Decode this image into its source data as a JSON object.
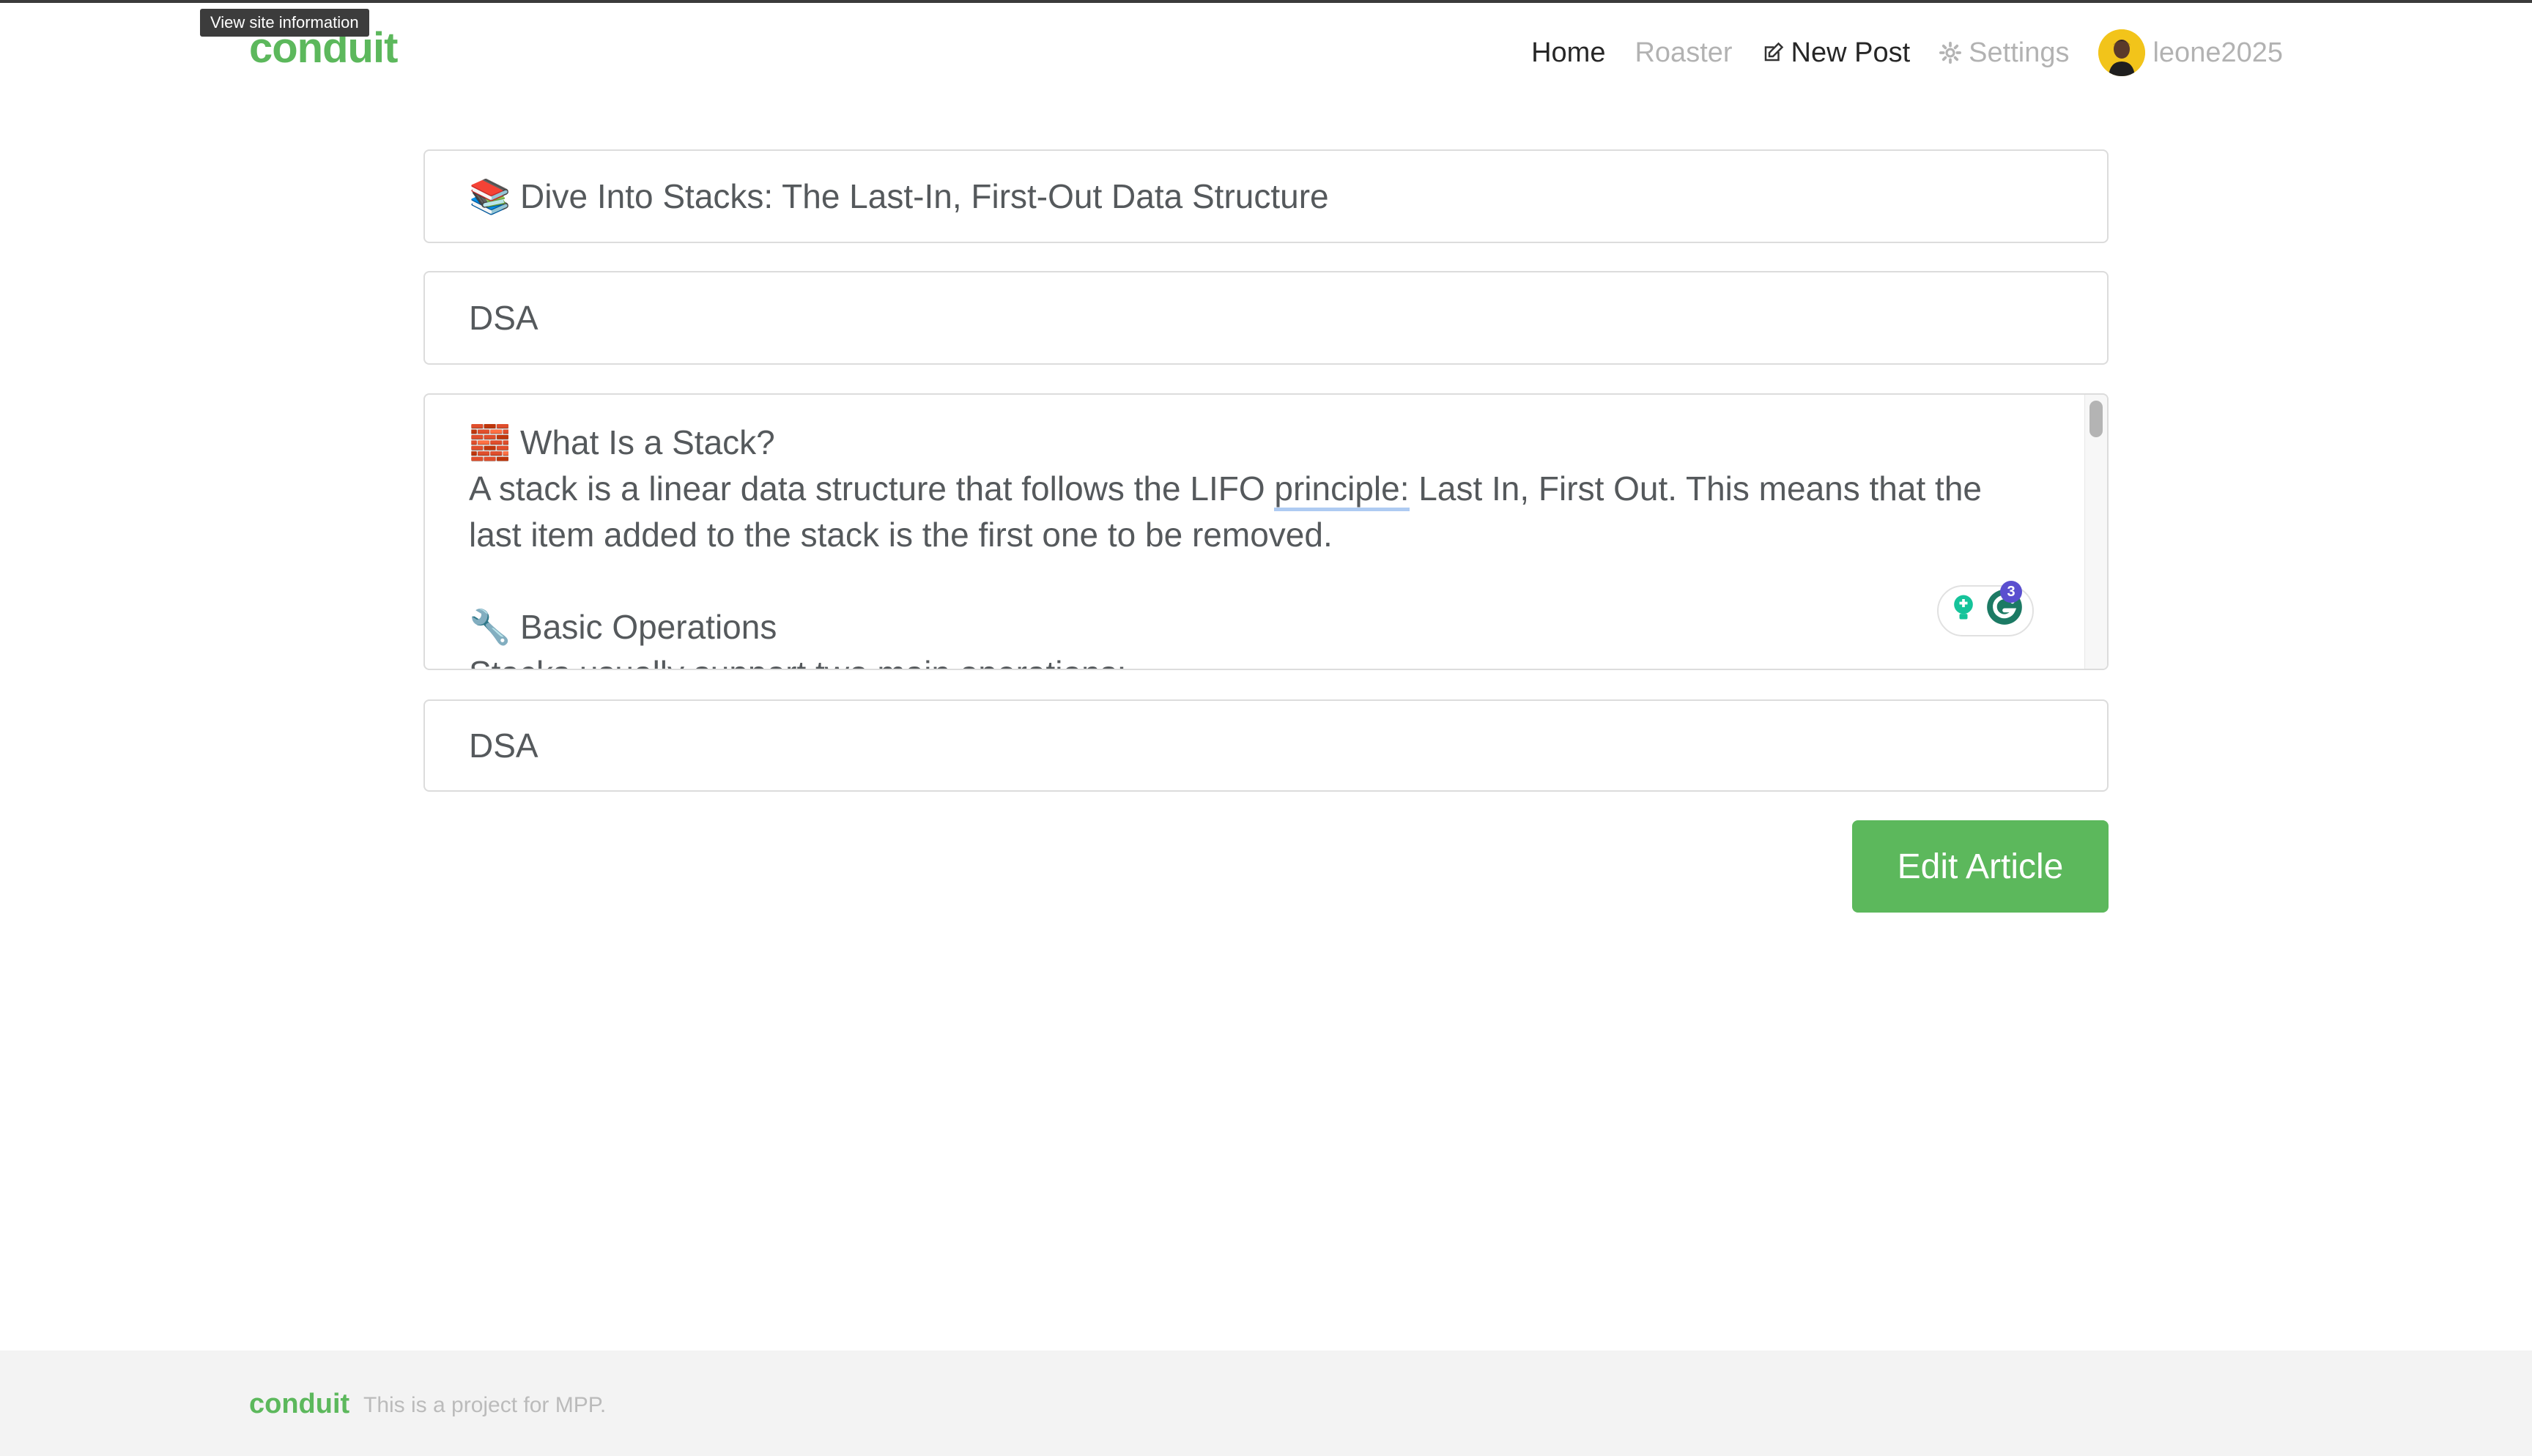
{
  "browser": {
    "tooltip": "View site information"
  },
  "navbar": {
    "brand": "conduit",
    "items": [
      {
        "label": "Home"
      },
      {
        "label": "Roaster"
      },
      {
        "label": "New Post",
        "icon": "compose-icon"
      },
      {
        "label": "Settings",
        "icon": "gear-icon"
      },
      {
        "label": "leone2025",
        "icon": "avatar"
      }
    ]
  },
  "editor": {
    "title_value": "📚 Dive Into Stacks: The Last-In, First-Out Data Structure",
    "about_value": "DSA",
    "body": {
      "line1": "🧱 What Is a Stack?",
      "line2a": "A stack is a linear data structure that follows the LIFO ",
      "line2u": "principle:",
      "line2b": " Last In, First Out. This means that the last item added to the stack is the first one to be removed.",
      "line3": "🔧 Basic Operations",
      "line4": "Stacks usually support two main operations:"
    },
    "grammarly_count": "3",
    "tags_value": "DSA",
    "submit_label": "Edit Article"
  },
  "footer": {
    "brand": "conduit",
    "text": "This is a project for MPP."
  },
  "colors": {
    "brand": "#5cb85c",
    "grammarly_badge": "#5a4fcf"
  }
}
